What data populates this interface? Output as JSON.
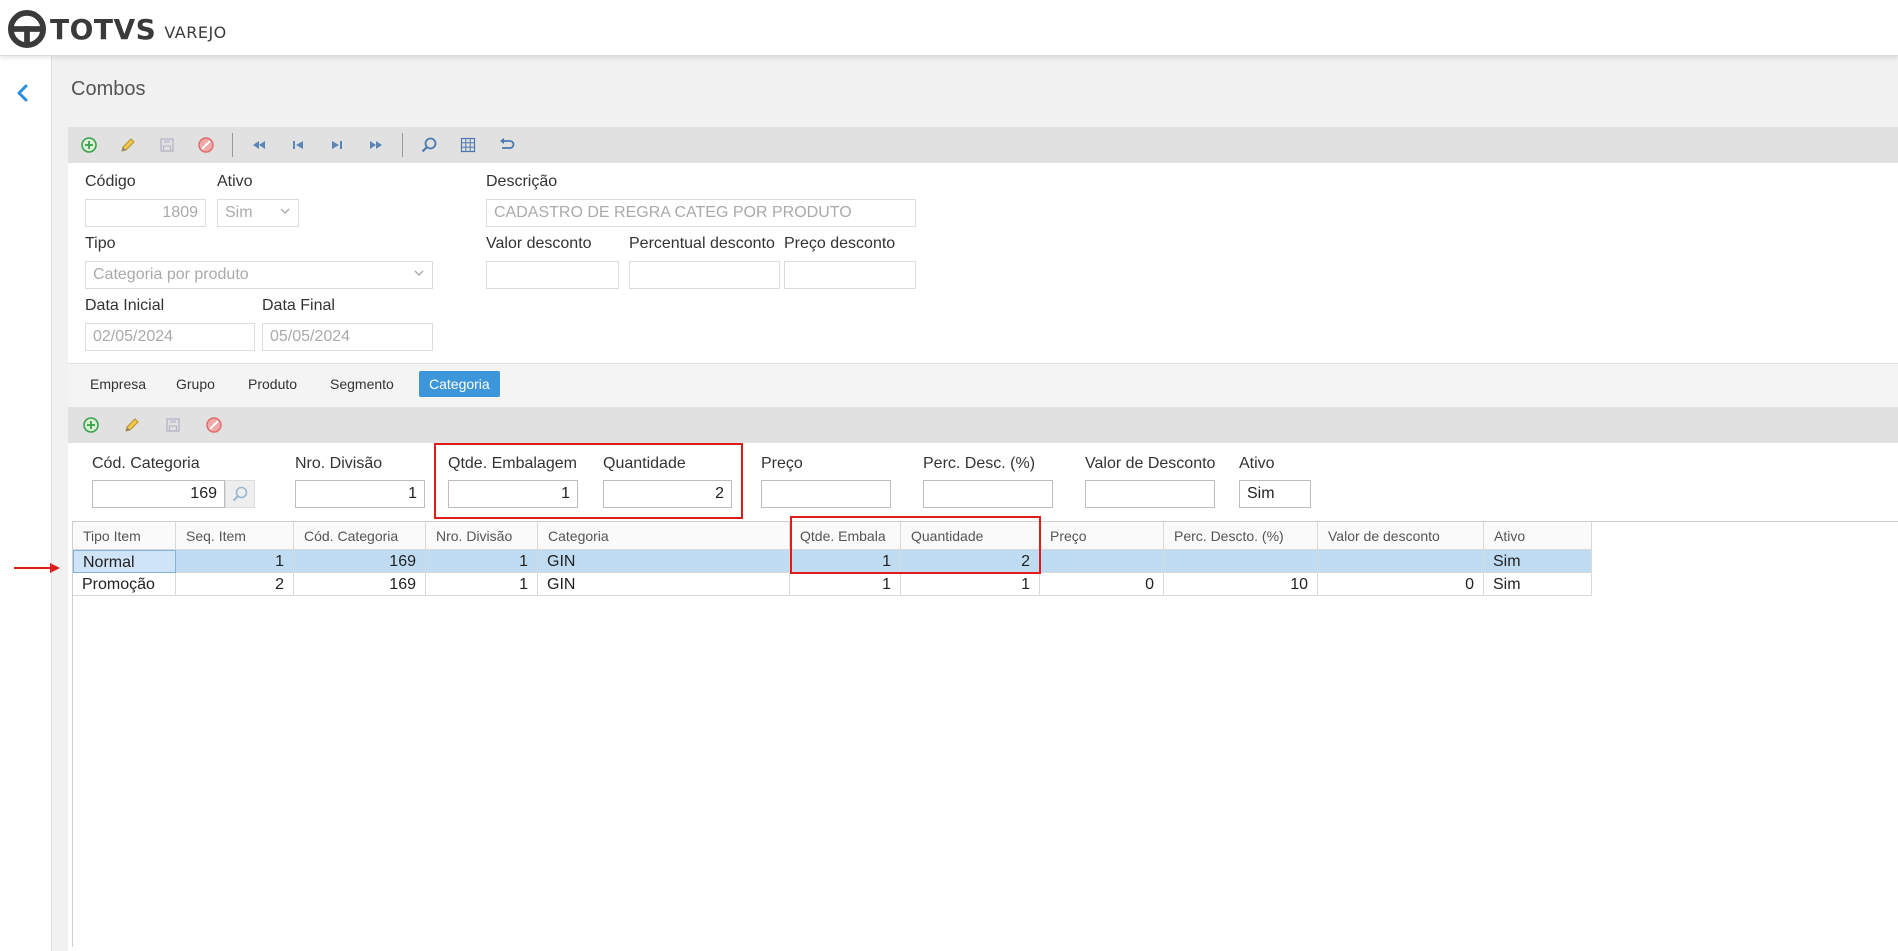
{
  "header": {
    "brand": "TOTVS",
    "product": "VAREJO"
  },
  "page": {
    "title": "Combos"
  },
  "toolbar_icons": [
    "add-icon",
    "edit-icon",
    "save-icon",
    "cancel-icon",
    "first-icon",
    "prev-icon",
    "next-icon",
    "last-icon",
    "search-icon",
    "grid-icon",
    "undo-icon"
  ],
  "form": {
    "codigo": {
      "label": "Código",
      "value": "1809"
    },
    "ativo": {
      "label": "Ativo",
      "value": "Sim"
    },
    "descricao": {
      "label": "Descrição",
      "value": "CADASTRO DE REGRA CATEG POR PRODUTO"
    },
    "tipo": {
      "label": "Tipo",
      "value": "Categoria por produto"
    },
    "valor_desconto": {
      "label": "Valor desconto",
      "value": ""
    },
    "percentual_desconto": {
      "label": "Percentual desconto",
      "value": ""
    },
    "preco_desconto": {
      "label": "Preço desconto",
      "value": ""
    },
    "data_inicial": {
      "label": "Data Inicial",
      "value": "02/05/2024"
    },
    "data_final": {
      "label": "Data Final",
      "value": "05/05/2024"
    }
  },
  "tabs": [
    {
      "label": "Empresa",
      "active": false
    },
    {
      "label": "Grupo",
      "active": false
    },
    {
      "label": "Produto",
      "active": false
    },
    {
      "label": "Segmento",
      "active": false
    },
    {
      "label": "Categoria",
      "active": true
    }
  ],
  "detail": {
    "cod_categoria": {
      "label": "Cód. Categoria",
      "value": "169"
    },
    "nro_divisao": {
      "label": "Nro. Divisão",
      "value": "1"
    },
    "qtde_embalagem": {
      "label": "Qtde. Embalagem",
      "value": "1"
    },
    "quantidade": {
      "label": "Quantidade",
      "value": "2"
    },
    "preco": {
      "label": "Preço",
      "value": ""
    },
    "perc_desc": {
      "label": "Perc. Desc. (%)",
      "value": ""
    },
    "valor_de_desconto": {
      "label": "Valor de Desconto",
      "value": ""
    },
    "ativo": {
      "label": "Ativo",
      "value": "Sim"
    }
  },
  "grid": {
    "columns": [
      "Tipo Item",
      "Seq. Item",
      "Cód. Categoria",
      "Nro. Divisão",
      "Categoria",
      "Qtde. Embala",
      "Quantidade",
      "Preço",
      "Perc. Descto. (%)",
      "Valor de desconto",
      "Ativo"
    ],
    "rows": [
      [
        "Normal",
        "1",
        "169",
        "1",
        "GIN",
        "1",
        "2",
        "",
        "",
        "",
        "Sim"
      ],
      [
        "Promoção",
        "2",
        "169",
        "1",
        "GIN",
        "1",
        "1",
        "0",
        "10",
        "0",
        "Sim"
      ]
    ],
    "selected_row": 0
  },
  "colors": {
    "accent": "#3c96d9",
    "highlight": "#e01b1b",
    "selected_row": "#bfdcf3",
    "toolbar": "#e1e1e1"
  }
}
